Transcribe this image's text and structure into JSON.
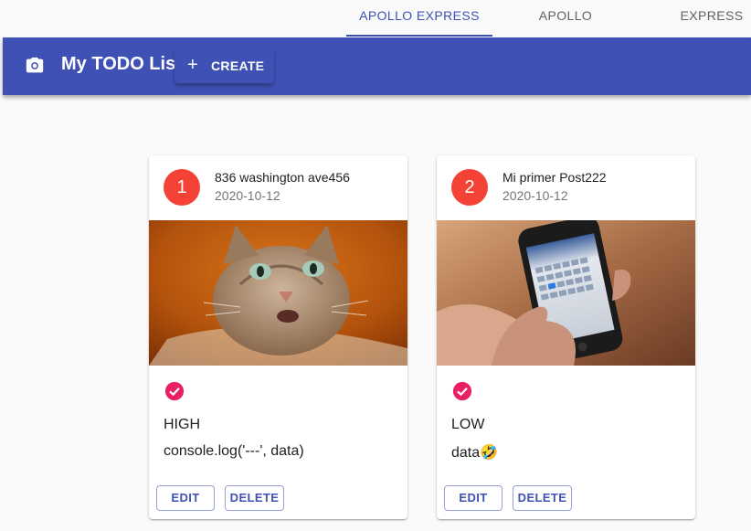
{
  "tabs": [
    {
      "label": "APOLLO EXPRESS",
      "active": true
    },
    {
      "label": "APOLLO",
      "active": false
    },
    {
      "label": "EXPRESS",
      "active": false
    }
  ],
  "appbar": {
    "icon": "camera-icon",
    "title": "My TODO List",
    "create_label": "CREATE",
    "create_icon": "plus-icon"
  },
  "colors": {
    "primary": "#3f51b5",
    "avatar": "#f44336",
    "check": "#e91e63"
  },
  "cards": [
    {
      "avatar": "1",
      "title": "836 washington ave456",
      "date": "2020-10-12",
      "image": "cat-photo",
      "status_icon": "check-circle-icon",
      "priority": "HIGH",
      "description": "console.log('---', data)",
      "edit_label": "EDIT",
      "delete_label": "DELETE"
    },
    {
      "avatar": "2",
      "title": "Mi primer Post222",
      "date": "2020-10-12",
      "image": "phone-calendar-photo",
      "status_icon": "check-circle-icon",
      "priority": "LOW",
      "description": "data🤣",
      "edit_label": "EDIT",
      "delete_label": "DELETE"
    }
  ]
}
